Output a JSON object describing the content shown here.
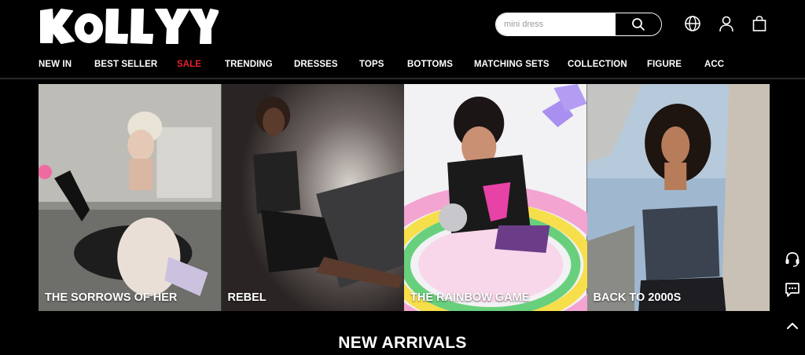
{
  "header": {
    "logo_text": "KOLLYY",
    "search": {
      "placeholder": "mini dress",
      "value": ""
    },
    "icons": [
      "globe-icon",
      "account-icon",
      "bag-icon"
    ]
  },
  "nav": {
    "items": [
      {
        "label": "NEW IN"
      },
      {
        "label": "BEST SELLER"
      },
      {
        "label": "SALE"
      },
      {
        "label": "TRENDING"
      },
      {
        "label": "DRESSES"
      },
      {
        "label": "TOPS"
      },
      {
        "label": "BOTTOMS"
      },
      {
        "label": "MATCHING SETS"
      },
      {
        "label": "COLLECTION"
      },
      {
        "label": "FIGURE"
      },
      {
        "label": "ACC"
      }
    ],
    "sale_color": "#e8212a"
  },
  "banners": [
    {
      "label": "THE SORROWS OF HER"
    },
    {
      "label": "REBEL"
    },
    {
      "label": "THE RAINBOW GAME"
    },
    {
      "label": "BACK TO 2000S"
    }
  ],
  "section": {
    "title": "NEW ARRIVALS"
  },
  "floating": [
    "headset-icon",
    "chat-icon",
    "chevron-up-icon"
  ]
}
